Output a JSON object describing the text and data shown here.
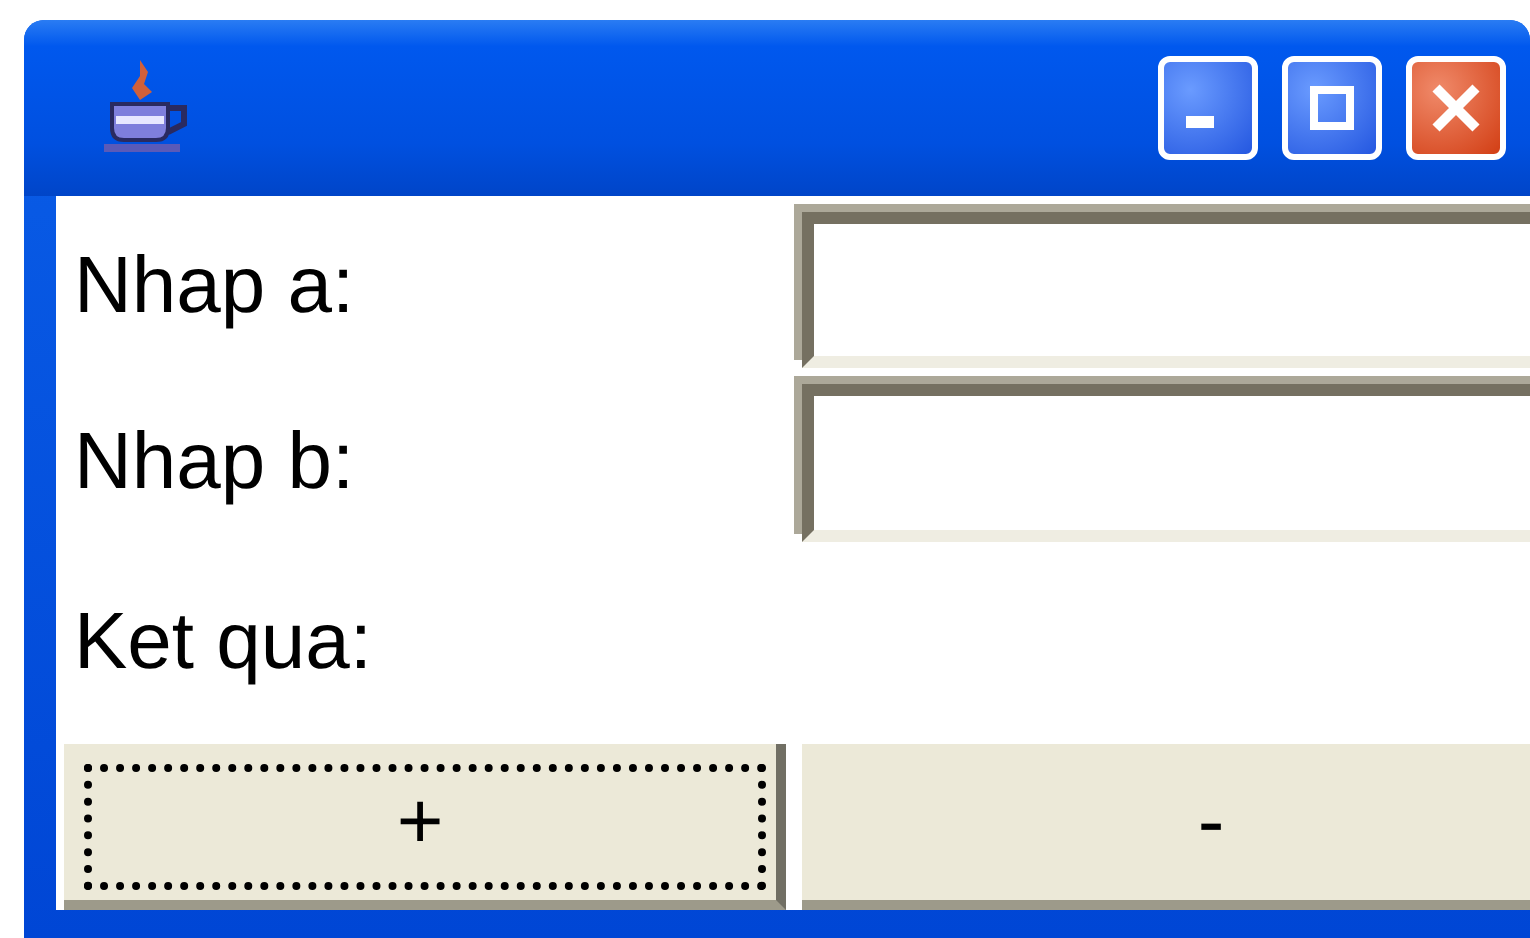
{
  "form": {
    "rows": [
      {
        "kind": "input",
        "label": "Nhap a:"
      },
      {
        "kind": "input",
        "label": "Nhap b:"
      },
      {
        "kind": "output",
        "label": "Ket qua:"
      }
    ]
  },
  "buttons": [
    {
      "label": "+",
      "focused": true
    },
    {
      "label": "-",
      "focused": false
    }
  ]
}
